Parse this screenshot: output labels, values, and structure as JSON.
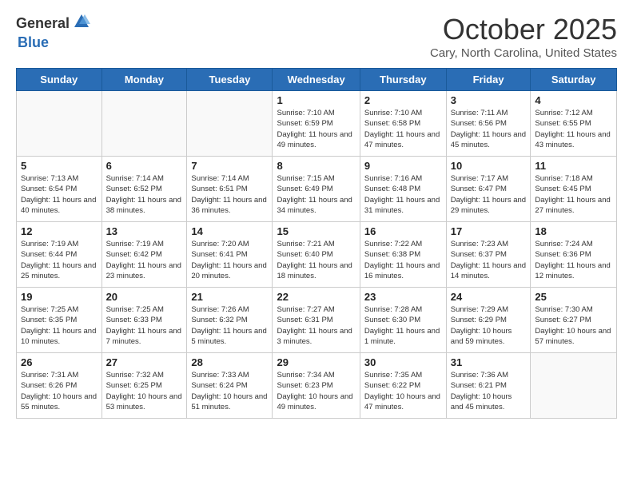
{
  "header": {
    "logo_general": "General",
    "logo_blue": "Blue",
    "month": "October 2025",
    "location": "Cary, North Carolina, United States"
  },
  "days_of_week": [
    "Sunday",
    "Monday",
    "Tuesday",
    "Wednesday",
    "Thursday",
    "Friday",
    "Saturday"
  ],
  "weeks": [
    [
      {
        "day": "",
        "info": ""
      },
      {
        "day": "",
        "info": ""
      },
      {
        "day": "",
        "info": ""
      },
      {
        "day": "1",
        "info": "Sunrise: 7:10 AM\nSunset: 6:59 PM\nDaylight: 11 hours and 49 minutes."
      },
      {
        "day": "2",
        "info": "Sunrise: 7:10 AM\nSunset: 6:58 PM\nDaylight: 11 hours and 47 minutes."
      },
      {
        "day": "3",
        "info": "Sunrise: 7:11 AM\nSunset: 6:56 PM\nDaylight: 11 hours and 45 minutes."
      },
      {
        "day": "4",
        "info": "Sunrise: 7:12 AM\nSunset: 6:55 PM\nDaylight: 11 hours and 43 minutes."
      }
    ],
    [
      {
        "day": "5",
        "info": "Sunrise: 7:13 AM\nSunset: 6:54 PM\nDaylight: 11 hours and 40 minutes."
      },
      {
        "day": "6",
        "info": "Sunrise: 7:14 AM\nSunset: 6:52 PM\nDaylight: 11 hours and 38 minutes."
      },
      {
        "day": "7",
        "info": "Sunrise: 7:14 AM\nSunset: 6:51 PM\nDaylight: 11 hours and 36 minutes."
      },
      {
        "day": "8",
        "info": "Sunrise: 7:15 AM\nSunset: 6:49 PM\nDaylight: 11 hours and 34 minutes."
      },
      {
        "day": "9",
        "info": "Sunrise: 7:16 AM\nSunset: 6:48 PM\nDaylight: 11 hours and 31 minutes."
      },
      {
        "day": "10",
        "info": "Sunrise: 7:17 AM\nSunset: 6:47 PM\nDaylight: 11 hours and 29 minutes."
      },
      {
        "day": "11",
        "info": "Sunrise: 7:18 AM\nSunset: 6:45 PM\nDaylight: 11 hours and 27 minutes."
      }
    ],
    [
      {
        "day": "12",
        "info": "Sunrise: 7:19 AM\nSunset: 6:44 PM\nDaylight: 11 hours and 25 minutes."
      },
      {
        "day": "13",
        "info": "Sunrise: 7:19 AM\nSunset: 6:42 PM\nDaylight: 11 hours and 23 minutes."
      },
      {
        "day": "14",
        "info": "Sunrise: 7:20 AM\nSunset: 6:41 PM\nDaylight: 11 hours and 20 minutes."
      },
      {
        "day": "15",
        "info": "Sunrise: 7:21 AM\nSunset: 6:40 PM\nDaylight: 11 hours and 18 minutes."
      },
      {
        "day": "16",
        "info": "Sunrise: 7:22 AM\nSunset: 6:38 PM\nDaylight: 11 hours and 16 minutes."
      },
      {
        "day": "17",
        "info": "Sunrise: 7:23 AM\nSunset: 6:37 PM\nDaylight: 11 hours and 14 minutes."
      },
      {
        "day": "18",
        "info": "Sunrise: 7:24 AM\nSunset: 6:36 PM\nDaylight: 11 hours and 12 minutes."
      }
    ],
    [
      {
        "day": "19",
        "info": "Sunrise: 7:25 AM\nSunset: 6:35 PM\nDaylight: 11 hours and 10 minutes."
      },
      {
        "day": "20",
        "info": "Sunrise: 7:25 AM\nSunset: 6:33 PM\nDaylight: 11 hours and 7 minutes."
      },
      {
        "day": "21",
        "info": "Sunrise: 7:26 AM\nSunset: 6:32 PM\nDaylight: 11 hours and 5 minutes."
      },
      {
        "day": "22",
        "info": "Sunrise: 7:27 AM\nSunset: 6:31 PM\nDaylight: 11 hours and 3 minutes."
      },
      {
        "day": "23",
        "info": "Sunrise: 7:28 AM\nSunset: 6:30 PM\nDaylight: 11 hours and 1 minute."
      },
      {
        "day": "24",
        "info": "Sunrise: 7:29 AM\nSunset: 6:29 PM\nDaylight: 10 hours and 59 minutes."
      },
      {
        "day": "25",
        "info": "Sunrise: 7:30 AM\nSunset: 6:27 PM\nDaylight: 10 hours and 57 minutes."
      }
    ],
    [
      {
        "day": "26",
        "info": "Sunrise: 7:31 AM\nSunset: 6:26 PM\nDaylight: 10 hours and 55 minutes."
      },
      {
        "day": "27",
        "info": "Sunrise: 7:32 AM\nSunset: 6:25 PM\nDaylight: 10 hours and 53 minutes."
      },
      {
        "day": "28",
        "info": "Sunrise: 7:33 AM\nSunset: 6:24 PM\nDaylight: 10 hours and 51 minutes."
      },
      {
        "day": "29",
        "info": "Sunrise: 7:34 AM\nSunset: 6:23 PM\nDaylight: 10 hours and 49 minutes."
      },
      {
        "day": "30",
        "info": "Sunrise: 7:35 AM\nSunset: 6:22 PM\nDaylight: 10 hours and 47 minutes."
      },
      {
        "day": "31",
        "info": "Sunrise: 7:36 AM\nSunset: 6:21 PM\nDaylight: 10 hours and 45 minutes."
      },
      {
        "day": "",
        "info": ""
      }
    ]
  ]
}
